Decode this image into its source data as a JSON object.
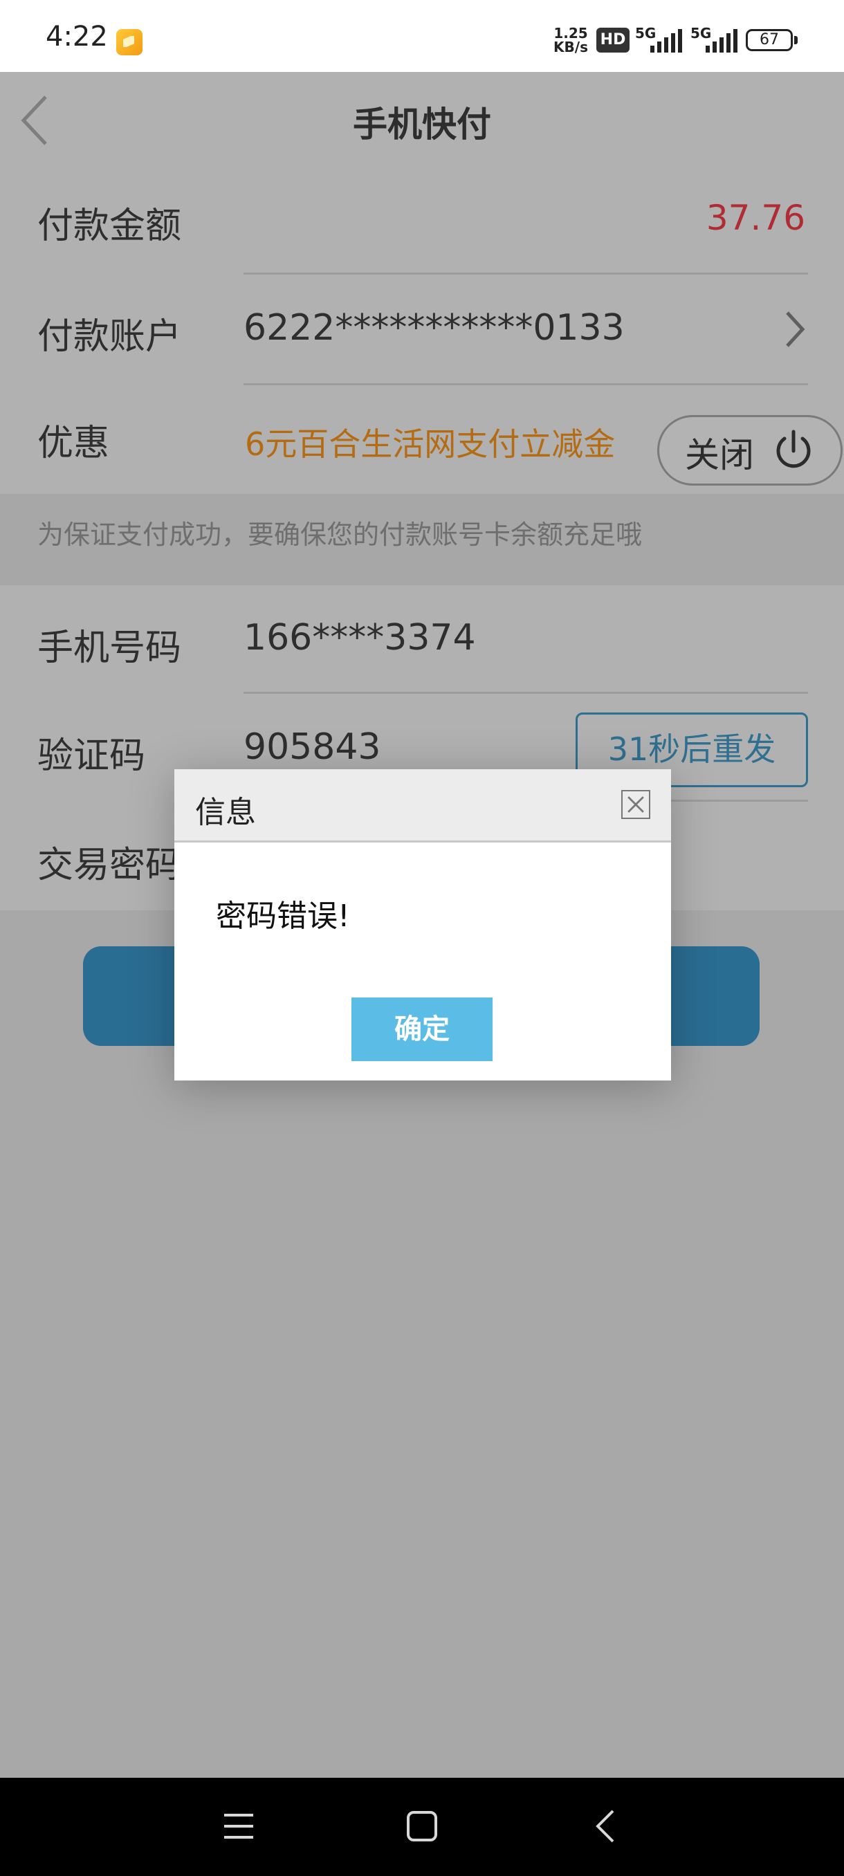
{
  "status_bar": {
    "time": "4:22",
    "net_speed_value": "1.25",
    "net_speed_unit": "KB/s",
    "hd_badge": "HD",
    "signal1_label": "5G",
    "signal2_label": "5G",
    "battery": "67"
  },
  "header": {
    "title": "手机快付",
    "back_icon": "chevron-left-icon"
  },
  "form": {
    "amount_label": "付款金额",
    "amount_value": "37.76",
    "account_label": "付款账户",
    "account_value": "6222***********0133",
    "discount_label": "优惠",
    "discount_value": "6元百合生活网支付立减金",
    "close_label": "关闭",
    "notice": "为保证支付成功，要确保您的付款账号卡余额充足哦",
    "phone_label": "手机号码",
    "phone_value": "166****3374",
    "code_label": "验证码",
    "code_value": "905843",
    "resend_label": "31秒后重发",
    "password_label": "交易密码"
  },
  "dialog": {
    "title": "信息",
    "message": "密码错误!",
    "confirm_label": "确定"
  },
  "colors": {
    "amount": "#d0303c",
    "discount": "#e08a1b",
    "resend": "#3a8cba",
    "confirm": "#5bbde6"
  }
}
